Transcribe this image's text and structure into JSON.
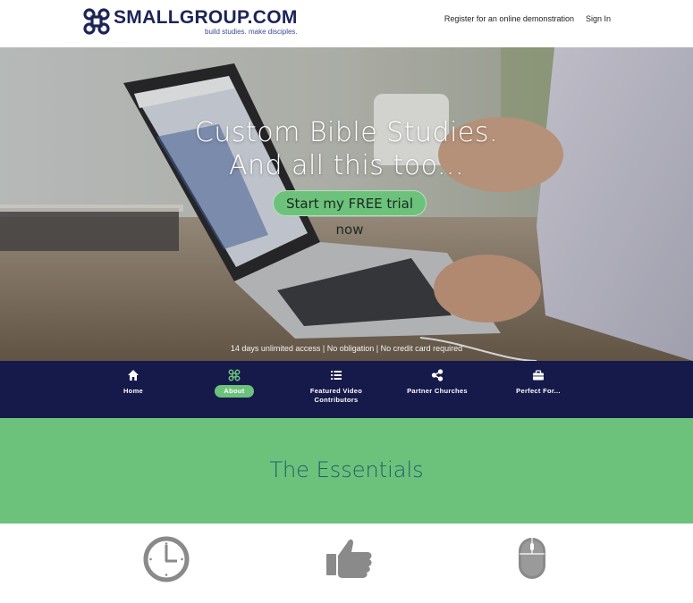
{
  "brand": {
    "name": "SMALLGROUP.COM",
    "tagline": "build studies. make disciples.",
    "colors": {
      "navy": "#161a4a",
      "green": "#6cc27b",
      "teal_text": "#1f5f6a"
    }
  },
  "top_nav": {
    "register_label": "Register for an online demonstration",
    "sign_in_label": "Sign In"
  },
  "hero": {
    "title_line1": "Custom Bible Studies.",
    "title_line2": "And all this too...",
    "cta_label": "Start my FREE trial now",
    "note": "14 days unlimited access | No obligation | No credit card required"
  },
  "section_nav": {
    "items": [
      {
        "label": "Home",
        "icon": "home-icon",
        "active": false
      },
      {
        "label": "About",
        "icon": "command-icon",
        "active": true
      },
      {
        "label_line1": "Featured Video",
        "label_line2": "Contributors",
        "icon": "list-icon",
        "active": false
      },
      {
        "label": "Partner Churches",
        "icon": "share-icon",
        "active": false
      },
      {
        "label": "Perfect For...",
        "icon": "briefcase-icon",
        "active": false
      }
    ]
  },
  "essentials": {
    "title": "The Essentials",
    "features": [
      {
        "icon": "clock-icon"
      },
      {
        "icon": "thumbs-up-icon"
      },
      {
        "icon": "mouse-icon"
      }
    ]
  }
}
